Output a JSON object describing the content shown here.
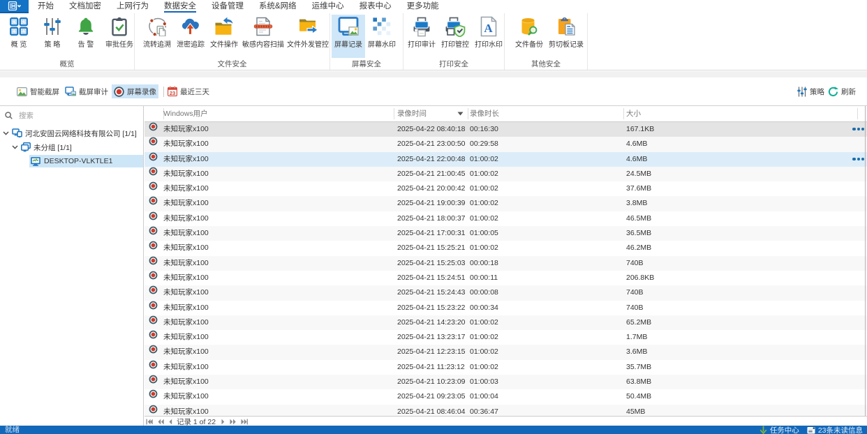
{
  "menu": {
    "app_button_icon": "app-grid-icon",
    "items": [
      {
        "label": "开始"
      },
      {
        "label": "文档加密"
      },
      {
        "label": "上网行为"
      },
      {
        "label": "数据安全",
        "active": true
      },
      {
        "label": "设备管理"
      },
      {
        "label": "系统&网络"
      },
      {
        "label": "运维中心"
      },
      {
        "label": "报表中心"
      },
      {
        "label": "更多功能"
      }
    ]
  },
  "ribbon": {
    "groups": [
      {
        "label": "概览",
        "buttons": [
          {
            "label": "概 览",
            "icon": "overview-grid-icon"
          },
          {
            "label": "策 略",
            "icon": "policy-sliders-icon"
          },
          {
            "label": "告 警",
            "icon": "alert-bell-icon"
          },
          {
            "label": "审批任务",
            "icon": "approval-clipboard-icon"
          }
        ]
      },
      {
        "label": "文件安全",
        "buttons": [
          {
            "label": "流转追溯",
            "icon": "trace-flow-icon"
          },
          {
            "label": "泄密追踪",
            "icon": "leak-track-cloud-icon"
          },
          {
            "label": "文件操作",
            "icon": "file-operation-folder-icon"
          },
          {
            "label": "敏感内容扫描",
            "icon": "sensitive-scan-icon"
          },
          {
            "label": "文件外发管控",
            "icon": "file-outgoing-folder-icon"
          }
        ]
      },
      {
        "label": "屏幕安全",
        "buttons": [
          {
            "label": "屏幕记录",
            "icon": "screen-record-icon",
            "active": true
          },
          {
            "label": "屏幕水印",
            "icon": "screen-watermark-icon"
          }
        ]
      },
      {
        "label": "打印安全",
        "buttons": [
          {
            "label": "打印审计",
            "icon": "print-audit-icon"
          },
          {
            "label": "打印管控",
            "icon": "print-control-icon"
          },
          {
            "label": "打印水印",
            "icon": "print-watermark-icon"
          }
        ]
      },
      {
        "label": "其他安全",
        "buttons": [
          {
            "label": "文件备份",
            "icon": "file-backup-icon"
          },
          {
            "label": "剪切板记录",
            "icon": "clipboard-record-icon"
          }
        ]
      }
    ]
  },
  "toolbar": {
    "left": [
      {
        "label": "智能截屏",
        "icon": "smart-screenshot-icon"
      },
      {
        "label": "截屏审计",
        "icon": "screenshot-audit-icon"
      },
      {
        "label": "屏幕录像",
        "icon": "screen-video-icon",
        "active": true
      },
      {
        "label": "最近三天",
        "icon": "calendar-icon",
        "sep_before": true
      }
    ],
    "right": [
      {
        "label": "策略",
        "icon": "policy-small-icon"
      },
      {
        "label": "刷新",
        "icon": "refresh-icon"
      }
    ]
  },
  "sidebar": {
    "search_placeholder": "搜索",
    "tree": [
      {
        "label": "河北安固云网络科技有限公司  [1/1]",
        "level": 0,
        "icon": "company-icon",
        "expanded": true
      },
      {
        "label": "未分组  [1/1]",
        "level": 1,
        "icon": "group-icon",
        "expanded": true
      },
      {
        "label": "DESKTOP-VLKTLE1",
        "level": 2,
        "icon": "computer-icon",
        "selected": true
      }
    ]
  },
  "table": {
    "columns": [
      {
        "label": "Windows用户"
      },
      {
        "label": "录像时间",
        "sort": "desc"
      },
      {
        "label": "录像时长"
      },
      {
        "label": "大小"
      }
    ],
    "rows": [
      {
        "user": "未知玩家x100",
        "time": "2025-04-22 08:40:18",
        "duration": "00:16:30",
        "size": "167.1KB",
        "state": "selected",
        "menu": true
      },
      {
        "user": "未知玩家x100",
        "time": "2025-04-21 23:00:50",
        "duration": "00:29:58",
        "size": "4.6MB"
      },
      {
        "user": "未知玩家x100",
        "time": "2025-04-21 22:00:48",
        "duration": "01:00:02",
        "size": "4.6MB",
        "state": "hover",
        "menu": true
      },
      {
        "user": "未知玩家x100",
        "time": "2025-04-21 21:00:45",
        "duration": "01:00:02",
        "size": "24.5MB"
      },
      {
        "user": "未知玩家x100",
        "time": "2025-04-21 20:00:42",
        "duration": "01:00:02",
        "size": "37.6MB"
      },
      {
        "user": "未知玩家x100",
        "time": "2025-04-21 19:00:39",
        "duration": "01:00:02",
        "size": "3.8MB"
      },
      {
        "user": "未知玩家x100",
        "time": "2025-04-21 18:00:37",
        "duration": "01:00:02",
        "size": "46.5MB"
      },
      {
        "user": "未知玩家x100",
        "time": "2025-04-21 17:00:31",
        "duration": "01:00:05",
        "size": "36.5MB"
      },
      {
        "user": "未知玩家x100",
        "time": "2025-04-21 15:25:21",
        "duration": "01:00:02",
        "size": "46.2MB"
      },
      {
        "user": "未知玩家x100",
        "time": "2025-04-21 15:25:03",
        "duration": "00:00:18",
        "size": "740B"
      },
      {
        "user": "未知玩家x100",
        "time": "2025-04-21 15:24:51",
        "duration": "00:00:11",
        "size": "206.8KB"
      },
      {
        "user": "未知玩家x100",
        "time": "2025-04-21 15:24:43",
        "duration": "00:00:08",
        "size": "740B"
      },
      {
        "user": "未知玩家x100",
        "time": "2025-04-21 15:23:22",
        "duration": "00:00:34",
        "size": "740B"
      },
      {
        "user": "未知玩家x100",
        "time": "2025-04-21 14:23:20",
        "duration": "01:00:02",
        "size": "65.2MB"
      },
      {
        "user": "未知玩家x100",
        "time": "2025-04-21 13:23:17",
        "duration": "01:00:02",
        "size": "1.7MB"
      },
      {
        "user": "未知玩家x100",
        "time": "2025-04-21 12:23:15",
        "duration": "01:00:02",
        "size": "3.6MB"
      },
      {
        "user": "未知玩家x100",
        "time": "2025-04-21 11:23:12",
        "duration": "01:00:02",
        "size": "35.7MB"
      },
      {
        "user": "未知玩家x100",
        "time": "2025-04-21 10:23:09",
        "duration": "01:00:03",
        "size": "63.8MB"
      },
      {
        "user": "未知玩家x100",
        "time": "2025-04-21 09:23:05",
        "duration": "01:00:04",
        "size": "50.4MB"
      },
      {
        "user": "未知玩家x100",
        "time": "2025-04-21 08:46:04",
        "duration": "00:36:47",
        "size": "45MB"
      }
    ]
  },
  "pagination": {
    "label": "记录 1 of 22"
  },
  "statusbar": {
    "ready": "就绪",
    "task_center": "任务中心",
    "unread": "23条未读信息"
  },
  "colors": {
    "accent_blue": "#1473c5",
    "statusbar_blue": "#1267b9",
    "selection_light_blue": "#cde6f7",
    "record_red": "#d0392a",
    "folder_yellow": "#f5af19",
    "alert_green": "#43a047",
    "refresh_teal": "#13ae9c"
  }
}
